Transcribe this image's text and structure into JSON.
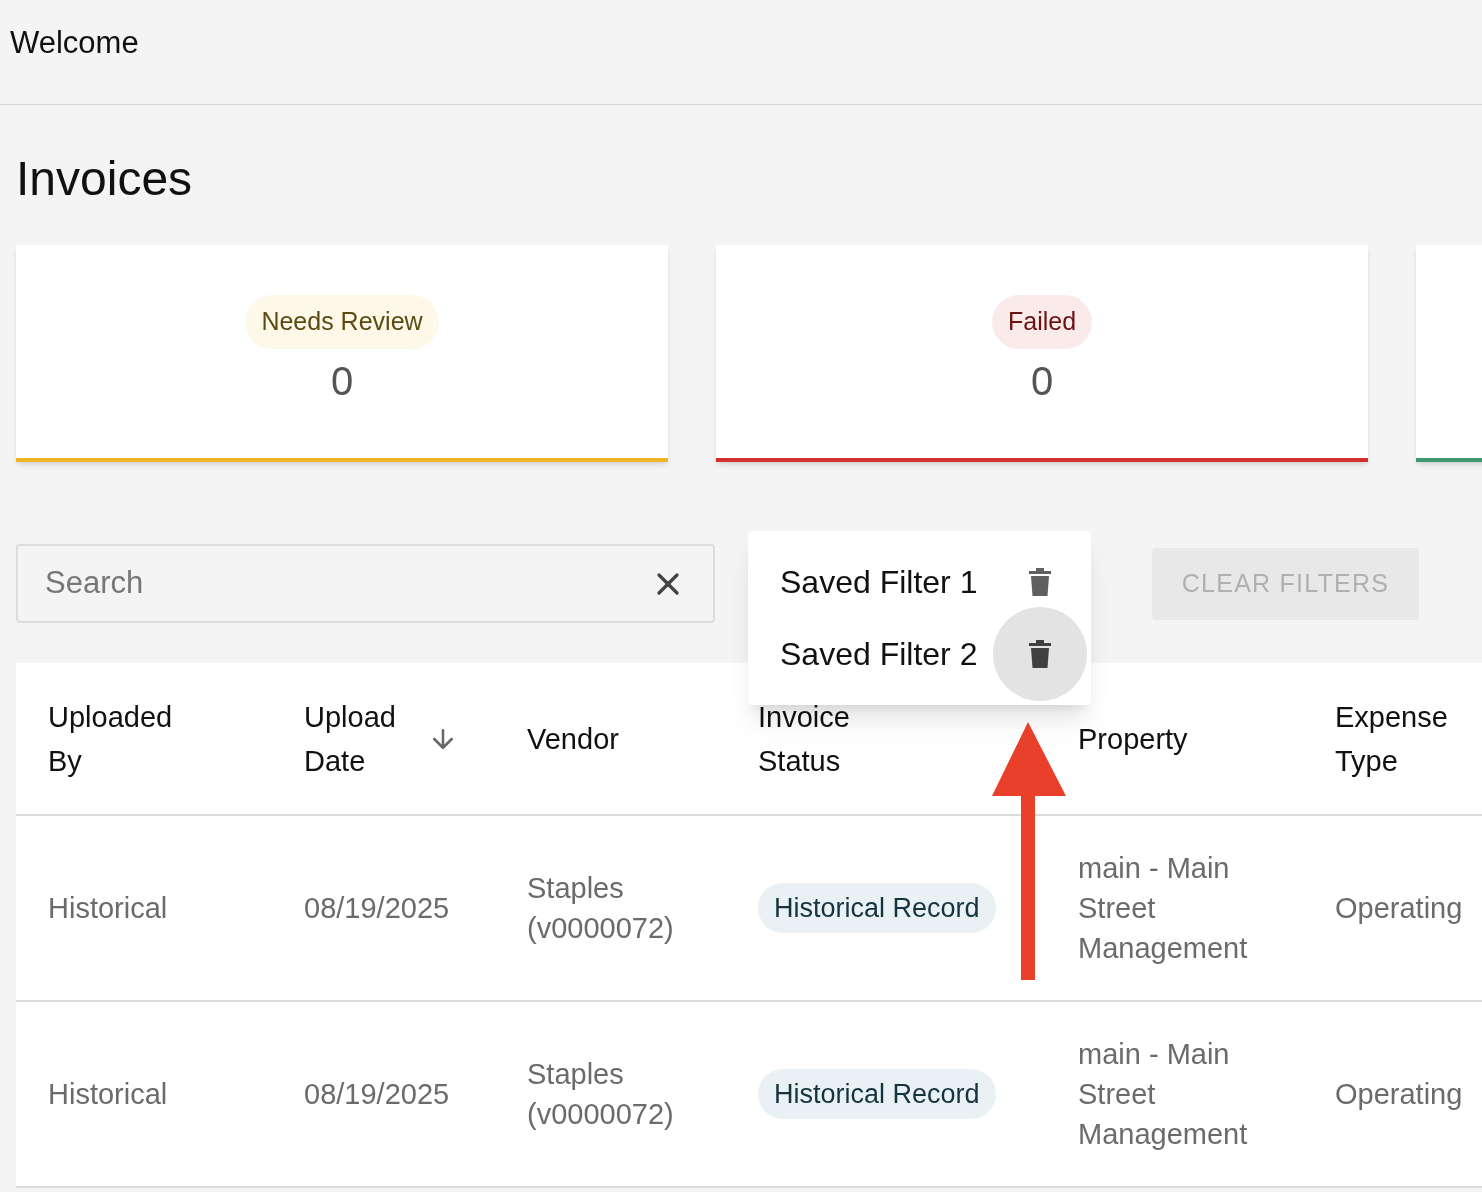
{
  "header": {
    "title": "Welcome"
  },
  "page_title": "Invoices",
  "status_cards": [
    {
      "label": "Needs Review",
      "count": "0",
      "color": "#f0b429"
    },
    {
      "label": "Failed",
      "count": "0",
      "color": "#d32f2f"
    },
    {
      "color": "#3d9970"
    }
  ],
  "search": {
    "placeholder": "Search"
  },
  "saved_filters_menu": [
    {
      "label": "Saved Filter 1",
      "highlighted": false
    },
    {
      "label": "Saved Filter 2",
      "highlighted": true
    }
  ],
  "clear_filters": {
    "label": "CLEAR FILTERS",
    "disabled": true
  },
  "table": {
    "columns": [
      {
        "label": "Uploaded By",
        "sorted": false
      },
      {
        "label": "Upload Date",
        "sorted": true
      },
      {
        "label": "Vendor",
        "sorted": false
      },
      {
        "label": "Invoice Status",
        "sorted": false
      },
      {
        "label": "Property",
        "sorted": false
      },
      {
        "label": "Expense Type",
        "sorted": false
      }
    ],
    "rows": [
      [
        "Historical",
        "08/19/2025",
        "Staples (v0000072)",
        "Historical Record",
        "main - Main Street Management",
        "Operating"
      ],
      [
        "Historical",
        "08/19/2025",
        "Staples (v0000072)",
        "Historical Record",
        "main - Main Street Management",
        "Operating"
      ]
    ]
  }
}
